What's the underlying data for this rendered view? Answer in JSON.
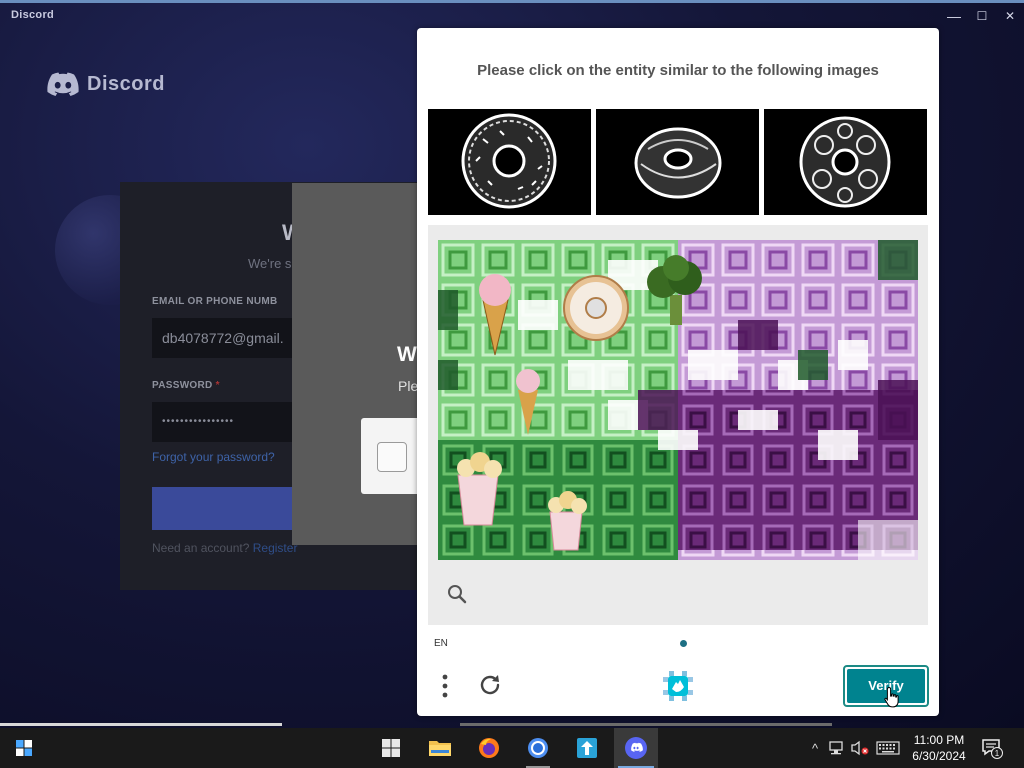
{
  "window": {
    "title": "Discord",
    "controls": {
      "minimize": "—",
      "maximize": "☐",
      "close": "✕"
    }
  },
  "logo": {
    "text": "Discord"
  },
  "login": {
    "heading": "W",
    "subheading": "We're s",
    "email_label": "EMAIL OR PHONE NUMB",
    "email_value": "db4078772@gmail.",
    "password_label": "PASSWORD",
    "password_required": "*",
    "password_value": "••••••••••••••••",
    "forgot_link": "Forgot your password?",
    "need_account": "Need an account?",
    "register_link": "Register"
  },
  "captcha_prompt": {
    "heading": "W",
    "subtext": "Ple"
  },
  "challenge": {
    "prompt": "Please click on the entity similar to the following images",
    "examples": [
      "donut-example-1",
      "donut-example-2",
      "donut-example-3"
    ],
    "task_objects": [
      "ice cream cone",
      "donut",
      "broccoli",
      "ice cream cone",
      "popcorn",
      "popcorn"
    ],
    "language": "EN",
    "verify_label": "Verify",
    "accent_color": "#00838f"
  },
  "taskbar": {
    "apps": [
      "windows-explorer",
      "file-explorer",
      "firefox",
      "chrome",
      "app-store",
      "discord"
    ],
    "tray": {
      "chevron": "^"
    },
    "clock": {
      "time": "11:00 PM",
      "date": "6/30/2024"
    },
    "notifications_count": "1"
  }
}
